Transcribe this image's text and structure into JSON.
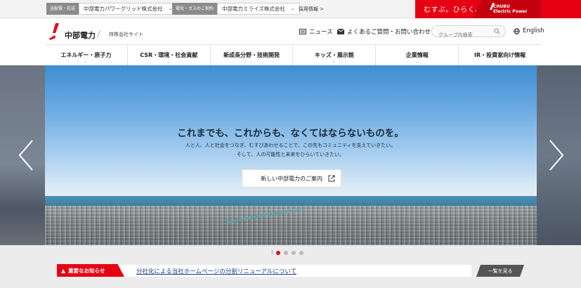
{
  "topbar": {
    "group1": {
      "tag": "送配電・託送",
      "select": "中部電力パワーグリッド株式会社"
    },
    "group2": {
      "tag": "電気・ガスのご契約",
      "select": "中部電力ミライズ株式会社"
    },
    "recruit": "採用情報 >",
    "slogan": "むすぶ。ひらく。",
    "brand_logo": "CHUBU\nElectric Power"
  },
  "header": {
    "logo": "中部電力",
    "subtitle": "持株会社サイト",
    "news": "ニュース",
    "faq": "よくあるご質問・お問い合わせ",
    "search_placeholder": "グループ内検索",
    "english": "English"
  },
  "nav": {
    "items": [
      {
        "label": "エネルギー・原子力"
      },
      {
        "label": "CSR・環境・社会貢献"
      },
      {
        "label": "新成長分野・技術開発"
      },
      {
        "label": "キッズ・展示館"
      },
      {
        "label": "企業情報"
      },
      {
        "label": "IR・投資家向け情報"
      }
    ]
  },
  "hero": {
    "title": "これまでも、これからも、なくてはならないものを。",
    "desc_line1": "人と人、人と社会をつなぎ、むすびあわせることで、この先もコミュニティを支えていきたい。",
    "desc_line2": "そして、人の可能性と未来をひらいていきたい。",
    "button": "新しい中部電力のご案内"
  },
  "pager": {
    "pause": "||",
    "active_index": 0,
    "count": 4
  },
  "notice": {
    "tag": "重要なお知らせ",
    "link": "分社化による当社ホームページの分割リニューアルについて",
    "more": "一覧を見る"
  },
  "colors": {
    "brand_red": "#e60012",
    "link_blue": "#1a3f8a"
  }
}
